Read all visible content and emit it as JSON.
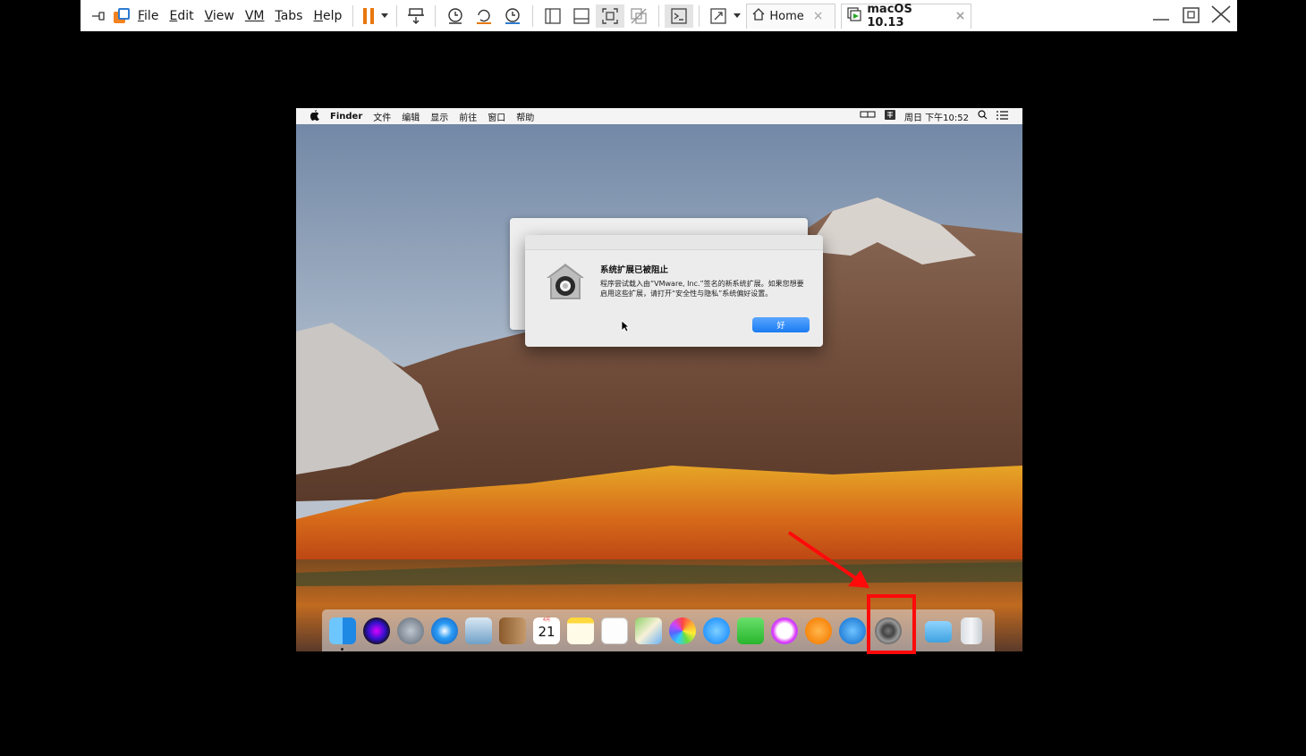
{
  "toolbar": {
    "menus": [
      {
        "label": "File",
        "ul": "F",
        "rest": "ile"
      },
      {
        "label": "Edit",
        "ul": "E",
        "rest": "dit"
      },
      {
        "label": "View",
        "ul": "V",
        "rest": "iew"
      },
      {
        "label": "VM",
        "ul": "VM",
        "rest": ""
      },
      {
        "label": "Tabs",
        "ul": "T",
        "rest": "abs"
      },
      {
        "label": "Help",
        "ul": "H",
        "rest": "elp"
      }
    ],
    "tabs": [
      {
        "label": "Home",
        "close": "×"
      },
      {
        "label": "macOS 10.13",
        "close": "×"
      }
    ],
    "accent_color": "#e8780f"
  },
  "mac": {
    "menubar": {
      "apple": "",
      "app": "Finder",
      "items": [
        "文件",
        "编辑",
        "显示",
        "前往",
        "窗口",
        "帮助"
      ],
      "clock": "周日 下午10:52"
    },
    "alert": {
      "title": "系统扩展已被阻止",
      "message": "程序尝试载入由“VMware, Inc.”签名的新系统扩展。如果您想要启用这些扩展，请打开“安全性与隐私”系统偏好设置。",
      "ok_label": "好"
    },
    "calendar": {
      "month": "4月",
      "day": "21"
    },
    "dock_apps": [
      "finder-icon",
      "siri-icon",
      "launchpad-icon",
      "safari-icon",
      "mail-icon",
      "contacts-icon",
      "calendar-icon",
      "notes-icon",
      "reminders-icon",
      "maps-icon",
      "photos-icon",
      "messages-icon",
      "facetime-icon",
      "itunes-icon",
      "ibooks-icon",
      "app-store-icon",
      "system-preferences-icon",
      "downloads-icon",
      "trash-icon"
    ],
    "highlight_color": "#ff0a0a"
  }
}
